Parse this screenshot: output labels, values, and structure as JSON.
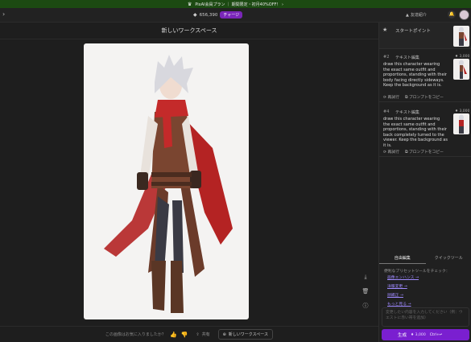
{
  "promo": {
    "text": "PixAI会員プラン ｜ 期間限定・初月40%OFF！ ›"
  },
  "header": {
    "credits": "656,390",
    "badge": "チャージ",
    "friend": "友達紹介"
  },
  "workspace": {
    "title": "新しいワークスペース"
  },
  "bottom_bar": {
    "question": "この画像はお気に入りましたか？",
    "share": "共有",
    "new_workspace": "新しいワークスペース"
  },
  "sidebar": {
    "start_point": "スタートポイント",
    "steps": [
      {
        "num": "#2",
        "kind": "テキスト編集",
        "cost": "3,000",
        "text": "draw this character wearing the exact same outfit and proportions, standing with their body facing directly sideways. Keep the background as it is.",
        "retry": "再試行",
        "copy": "プロンプトをコピー"
      },
      {
        "num": "#4",
        "kind": "テキスト編集",
        "cost": "3,000",
        "text": "draw this character wearing the exact same outfit and proportions, standing with their back completely turned to the viewer. Keep the background as it is.",
        "retry": "再試行",
        "copy": "プロンプトをコピー"
      }
    ],
    "tabs": {
      "free": "自由編集",
      "quick": "クイックツール"
    },
    "help": "便利なプリセットツールをチェック：",
    "links": [
      "画像エンハンス →",
      "洋服変更 →",
      "顔補正 →",
      "もっと見る →"
    ],
    "prompt_placeholder": "変更したい内容を入力してください（例：ウエストに赤い帯を追加）",
    "generate": {
      "label": "生成",
      "cost": "3,000",
      "shortcut": "Ctrl+↵"
    }
  },
  "colors": {
    "accent": "#7a1fd0",
    "promo_bg": "#1c4a12",
    "link": "#9f8aff"
  }
}
